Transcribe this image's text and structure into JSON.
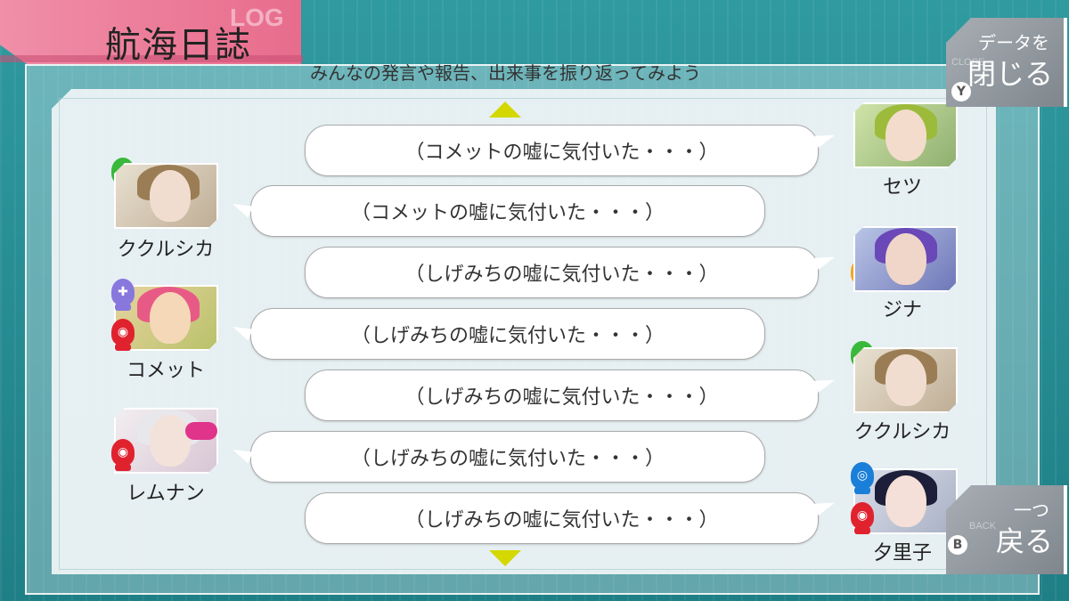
{
  "title": "航海日誌",
  "title_ghost": "LOG",
  "subtitle": "みんなの発言や報告、出来事を振り返ってみよう",
  "close_button": {
    "small": "データを",
    "big": "閉じる",
    "key": "Y",
    "ghost": "CLOSE"
  },
  "back_button": {
    "small": "一つ",
    "big": "戻る",
    "key": "B",
    "ghost": "BACK"
  },
  "entries": [
    {
      "side": "right",
      "speaker": "セツ",
      "text": "（コメットの嘘に気付いた・・・）"
    },
    {
      "side": "left",
      "speaker": "ククルシカ",
      "text": "（コメットの嘘に気付いた・・・）"
    },
    {
      "side": "right",
      "speaker": "ジナ",
      "text": "（しげみちの嘘に気付いた・・・）"
    },
    {
      "side": "left",
      "speaker": "コメット",
      "text": "（しげみちの嘘に気付いた・・・）"
    },
    {
      "side": "right",
      "speaker": "ククルシカ",
      "text": "（しげみちの嘘に気付いた・・・）"
    },
    {
      "side": "left",
      "speaker": "レムナン",
      "text": "（しげみちの嘘に気付いた・・・）"
    },
    {
      "side": "right",
      "speaker": "夕里子",
      "text": "（しげみちの嘘に気付いた・・・）"
    }
  ],
  "colors": {
    "title_bar": "#e86c8c",
    "scroll_arrow": "#d4d800",
    "background": "#2a8a90"
  }
}
